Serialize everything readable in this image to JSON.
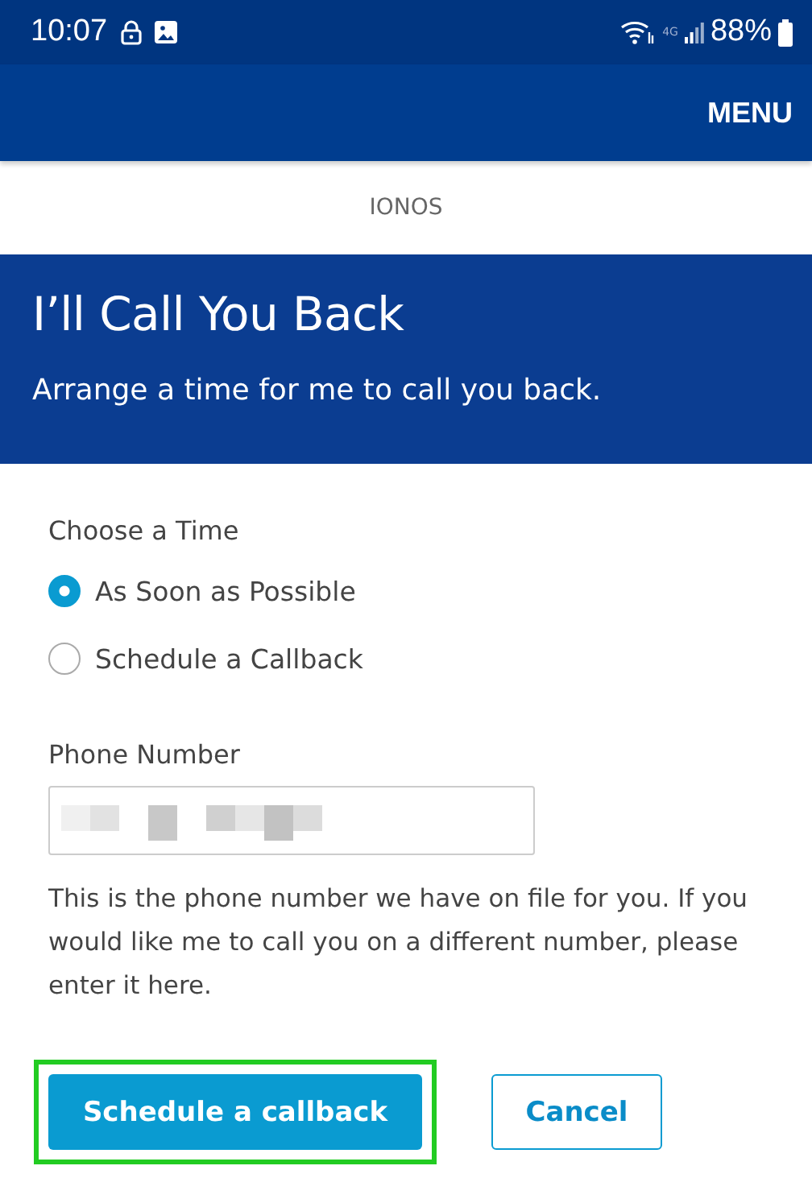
{
  "status_bar": {
    "time": "10:07",
    "network": "4G",
    "battery": "88%"
  },
  "nav": {
    "menu": "MENU"
  },
  "brand": "IONOS",
  "hero": {
    "title": "I’ll Call You Back",
    "subtitle": "Arrange a time for me to call you back."
  },
  "time_choice": {
    "label": "Choose a Time",
    "options": [
      {
        "label": "As Soon as Possible",
        "selected": true
      },
      {
        "label": "Schedule a Callback",
        "selected": false
      }
    ]
  },
  "phone": {
    "label": "Phone Number",
    "value_redacted": true,
    "help": "This is the phone number we have on file for you. If you would like me to call you on a different number, please enter it here."
  },
  "buttons": [
    {
      "kind": "primary",
      "label": "Schedule a callback",
      "highlighted": true
    },
    {
      "kind": "secondary",
      "label": "Cancel",
      "highlighted": false
    }
  ]
}
